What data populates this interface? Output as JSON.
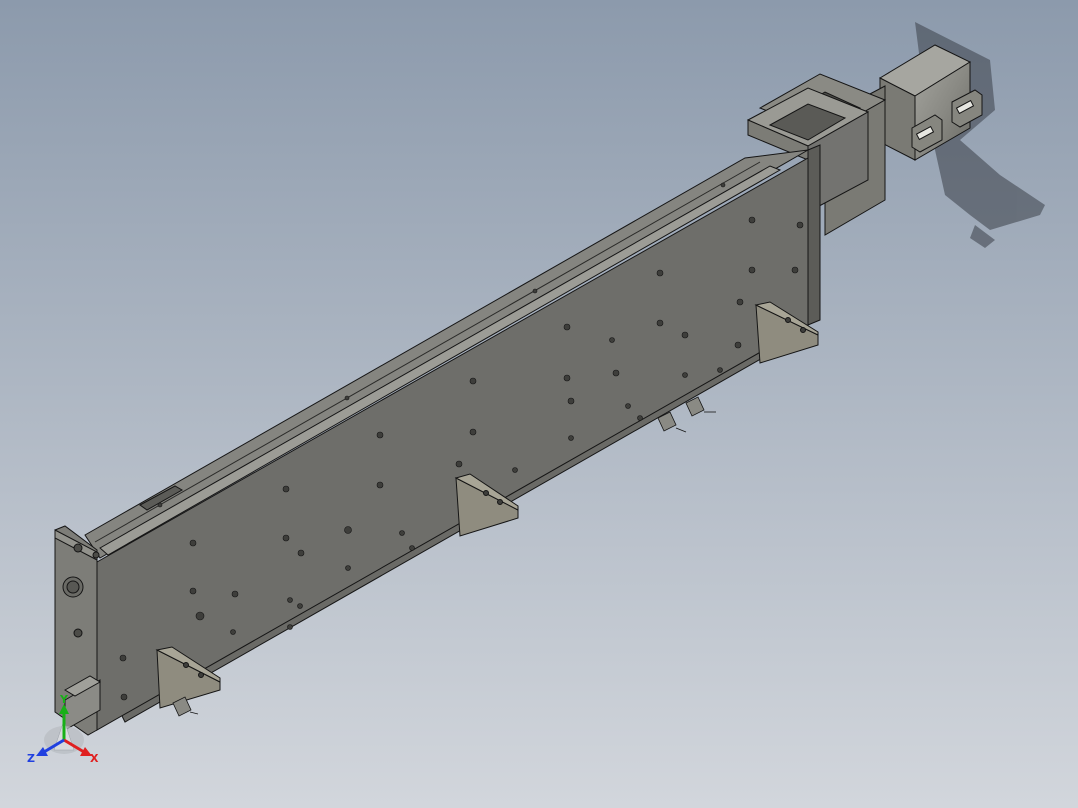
{
  "viewport": {
    "background_top": "#8c9aac",
    "background_bottom": "#d2d6dc",
    "model_face_color": "#6e6e6a",
    "model_top_color": "#858580",
    "model_edge_color": "#151515",
    "bracket_color": "#8f8c7f",
    "shadow_color": "#3a3f48"
  },
  "triad": {
    "x_label": "X",
    "y_label": "Y",
    "z_label": "Z",
    "x_color": "#e02020",
    "y_color": "#18b018",
    "z_color": "#2040e0"
  }
}
